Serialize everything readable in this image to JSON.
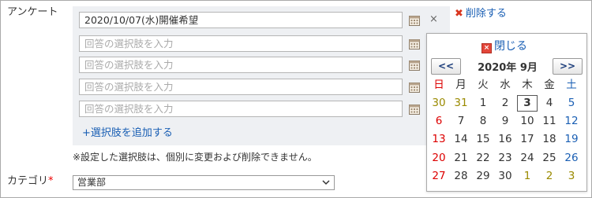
{
  "form": {
    "enquete_label": "アンケート",
    "category_label": "カテゴリ",
    "required_mark": "*",
    "choices": [
      {
        "value": "2020/10/07(水)開催希望",
        "placeholder": "回答の選択肢を入力"
      },
      {
        "value": "",
        "placeholder": "回答の選択肢を入力"
      },
      {
        "value": "",
        "placeholder": "回答の選択肢を入力"
      },
      {
        "value": "",
        "placeholder": "回答の選択肢を入力"
      },
      {
        "value": "",
        "placeholder": "回答の選択肢を入力"
      }
    ],
    "remove_choice": "×",
    "delete_link": "削除する",
    "add_choice": "+選択肢を追加する",
    "note": "※設定した選択肢は、個別に変更および削除できません。",
    "category_value": "営業部"
  },
  "calendar": {
    "close_label": "閉じる",
    "prev_label": "<<",
    "next_label": ">>",
    "month_title": "2020年 9月",
    "weekdays": [
      "日",
      "月",
      "火",
      "水",
      "木",
      "金",
      "土"
    ],
    "weeks": [
      [
        "30",
        "31",
        "1",
        "2",
        "3",
        "4",
        "5"
      ],
      [
        "6",
        "7",
        "8",
        "9",
        "10",
        "11",
        "12"
      ],
      [
        "13",
        "14",
        "15",
        "16",
        "17",
        "18",
        "19"
      ],
      [
        "20",
        "21",
        "22",
        "23",
        "24",
        "25",
        "26"
      ],
      [
        "27",
        "28",
        "29",
        "30",
        "1",
        "2",
        "3"
      ]
    ],
    "today": "3",
    "colors": {
      "sunday": "#d00000",
      "saturday": "#1a5fb4",
      "other_month": "#9a8a00"
    }
  }
}
